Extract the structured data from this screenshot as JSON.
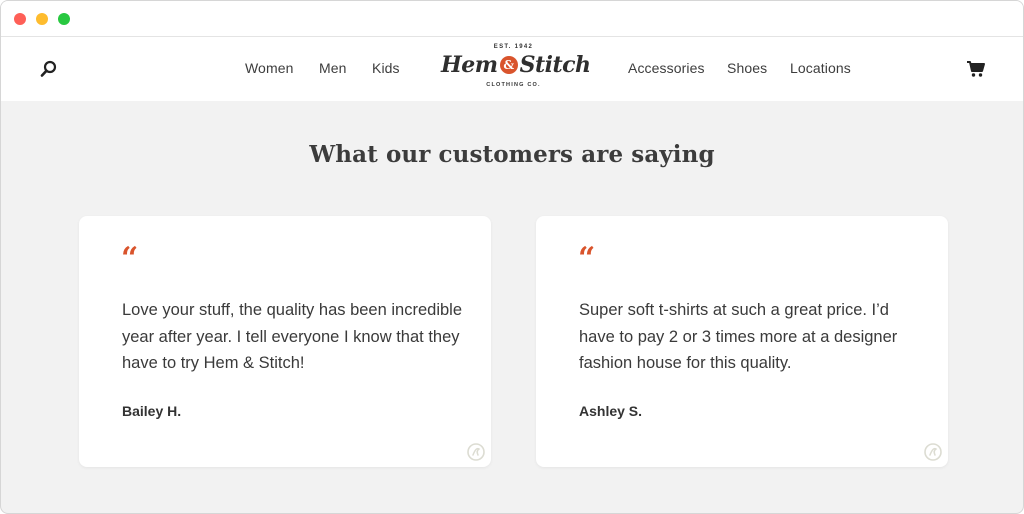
{
  "window": {
    "controls": {
      "close_color": "#fe5f57",
      "minimize_color": "#febc2e",
      "maximize_color": "#28c840"
    }
  },
  "nav": {
    "search_icon": "search-icon",
    "left_links": [
      "Women",
      "Men",
      "Kids"
    ],
    "right_links": [
      "Accessories",
      "Shoes",
      "Locations"
    ],
    "cart_icon": "cart-icon"
  },
  "logo": {
    "established": "EST. 1942",
    "name_part1": "Hem",
    "ampersand": "&",
    "name_part2": "Stitch",
    "tagline": "CLOTHING CO."
  },
  "colors": {
    "accent": "#d9542c",
    "page_background": "#f2f2f2",
    "card_background": "#ffffff"
  },
  "testimonials": {
    "heading": "What our customers are saying",
    "items": [
      {
        "quote_mark": "“",
        "text": "Love your stuff, the quality has been incredible year after year. I tell everyone I know that they have to try Hem & Stitch!",
        "author": "Bailey H."
      },
      {
        "quote_mark": "“",
        "text": "Super soft t-shirts at such a great price. I’d have to pay 2 or 3 times more at a designer fashion house for this quality.",
        "author": "Ashley S."
      }
    ]
  }
}
